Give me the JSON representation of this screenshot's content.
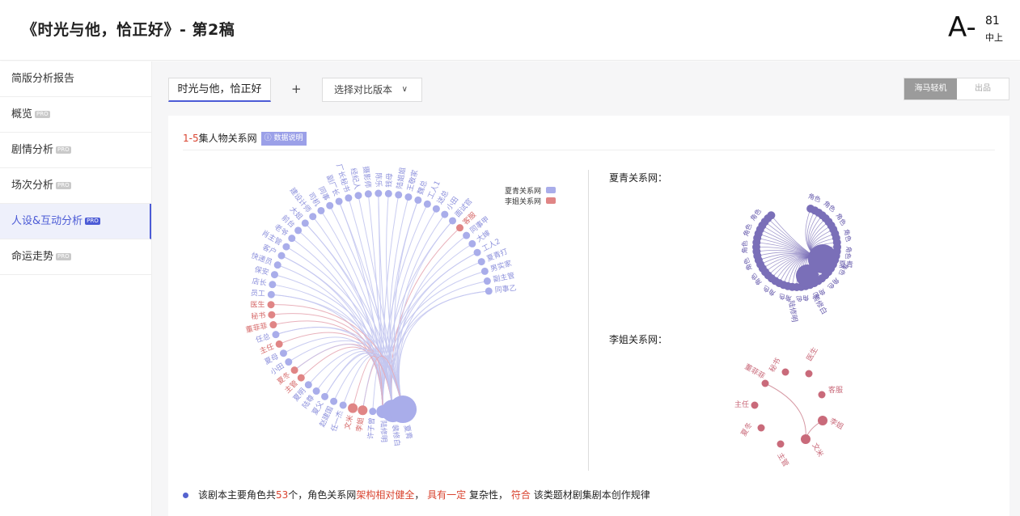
{
  "header": {
    "title": "《时光与他，恰正好》- 第2稿",
    "grade": "A-",
    "score": "81",
    "score_level": "中上"
  },
  "sidebar": {
    "items": [
      {
        "label": "简版分析报告",
        "pro": false
      },
      {
        "label": "概览",
        "pro": true
      },
      {
        "label": "剧情分析",
        "pro": true
      },
      {
        "label": "场次分析",
        "pro": true
      },
      {
        "label": "人设&互动分析",
        "pro": true,
        "active": true
      },
      {
        "label": "命运走势",
        "pro": true
      }
    ],
    "pro_label": "PRO"
  },
  "toolbar": {
    "tab": "时光与他，恰正好",
    "add": "+",
    "compare": "选择对比版本",
    "seg_a": "海马轻机",
    "seg_b": "出品"
  },
  "section": {
    "range": "1-5",
    "title": "集人物关系网",
    "info": "数据说明"
  },
  "legend": {
    "a": "夏青关系网",
    "b": "李姐关系网",
    "color_a": "#a9adea",
    "color_b": "#e08585"
  },
  "network": {
    "characters": [
      {
        "name": "同事乙",
        "c": "b"
      },
      {
        "name": "副主管",
        "c": "b"
      },
      {
        "name": "男实家",
        "c": "b"
      },
      {
        "name": "夏青打",
        "c": "b"
      },
      {
        "name": "工人2",
        "c": "b"
      },
      {
        "name": "大婶",
        "c": "b"
      },
      {
        "name": "同事甲",
        "c": "b"
      },
      {
        "name": "客服",
        "c": "r"
      },
      {
        "name": "面试官",
        "c": "b"
      },
      {
        "name": "小田",
        "c": "b"
      },
      {
        "name": "送总",
        "c": "b"
      },
      {
        "name": "工人1",
        "c": "b"
      },
      {
        "name": "魏总",
        "c": "b"
      },
      {
        "name": "王敬家",
        "c": "b"
      },
      {
        "name": "陆姐姐",
        "c": "b"
      },
      {
        "name": "钱母",
        "c": "b"
      },
      {
        "name": "陈乐",
        "c": "b"
      },
      {
        "name": "摄影师",
        "c": "b"
      },
      {
        "name": "经纪人",
        "c": "b"
      },
      {
        "name": "厂长秘书",
        "c": "b"
      },
      {
        "name": "副厂长",
        "c": "b"
      },
      {
        "name": "同事",
        "c": "b"
      },
      {
        "name": "司机",
        "c": "b"
      },
      {
        "name": "建设计师",
        "c": "b"
      },
      {
        "name": "大姐",
        "c": "b"
      },
      {
        "name": "前台",
        "c": "b"
      },
      {
        "name": "老爷",
        "c": "b"
      },
      {
        "name": "肖主管",
        "c": "b"
      },
      {
        "name": "客户",
        "c": "b"
      },
      {
        "name": "快递员",
        "c": "b"
      },
      {
        "name": "保安",
        "c": "b"
      },
      {
        "name": "店长",
        "c": "b"
      },
      {
        "name": "员工",
        "c": "b"
      },
      {
        "name": "医生",
        "c": "r"
      },
      {
        "name": "秘书",
        "c": "r"
      },
      {
        "name": "董菲菲",
        "c": "r"
      },
      {
        "name": "任总",
        "c": "b"
      },
      {
        "name": "主任",
        "c": "r"
      },
      {
        "name": "夏母",
        "c": "b"
      },
      {
        "name": "小田",
        "c": "b"
      },
      {
        "name": "夏冬",
        "c": "r"
      },
      {
        "name": "主管",
        "c": "r"
      },
      {
        "name": "夏明",
        "c": "b"
      },
      {
        "name": "陆尊",
        "c": "b"
      },
      {
        "name": "夏父",
        "c": "b"
      },
      {
        "name": "赵建国",
        "c": "b"
      },
      {
        "name": "任一杰",
        "c": "b"
      },
      {
        "name": "文米",
        "c": "r"
      },
      {
        "name": "李姐",
        "c": "r"
      },
      {
        "name": "许子曾",
        "c": "b"
      },
      {
        "name": "陆修明",
        "c": "b"
      },
      {
        "name": "裴修白",
        "c": "b"
      },
      {
        "name": "夏青",
        "c": "b"
      }
    ]
  },
  "xiaqing_net": {
    "title": "夏青关系网：",
    "labels": [
      "夏青",
      "裴修白",
      "陆修明"
    ]
  },
  "lijie_net": {
    "title": "李姐关系网：",
    "nodes": [
      "秘书",
      "医生",
      "董菲菲",
      "客服",
      "主任",
      "李姐",
      "夏冬",
      "文米",
      "主管"
    ]
  },
  "summary": {
    "pre": "该剧本主要角色共",
    "count": "53",
    "mid": "个，角色关系网",
    "s1": "架构相对健全",
    "c1": "，",
    "s2": "具有一定",
    "c2": "复杂性，",
    "s3": "符合",
    "post": "该类题材剧集剧本创作规律"
  }
}
